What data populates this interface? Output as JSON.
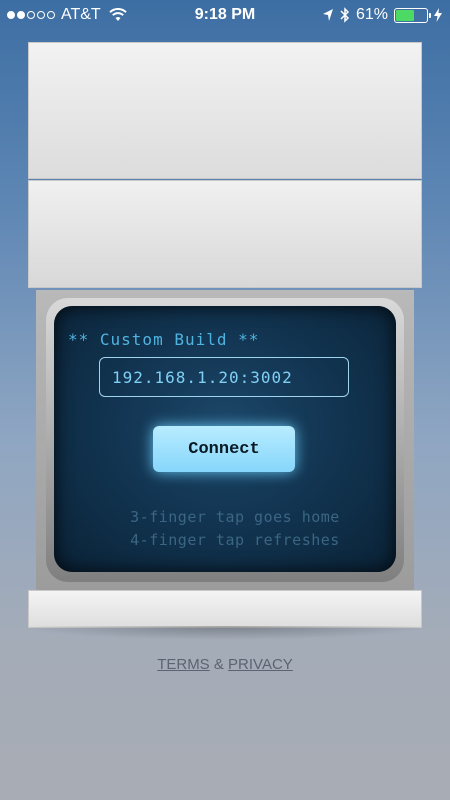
{
  "status_bar": {
    "carrier": "AT&T",
    "time": "9:18 PM",
    "battery_percent": "61%",
    "battery_level": 0.61,
    "signal_bars_filled": 2,
    "signal_bars_total": 5,
    "battery_color": "#4cd964"
  },
  "screen": {
    "title": "** Custom Build **",
    "host_value": "192.168.1.20:3002",
    "connect_label": "Connect",
    "hint_1": "3-finger tap goes home",
    "hint_2": "4-finger tap refreshes"
  },
  "footer": {
    "terms": "TERMS",
    "amp": "&",
    "privacy": "PRIVACY"
  },
  "colors": {
    "accent": "#86d6fb",
    "screen_text": "#4fb3e0"
  }
}
